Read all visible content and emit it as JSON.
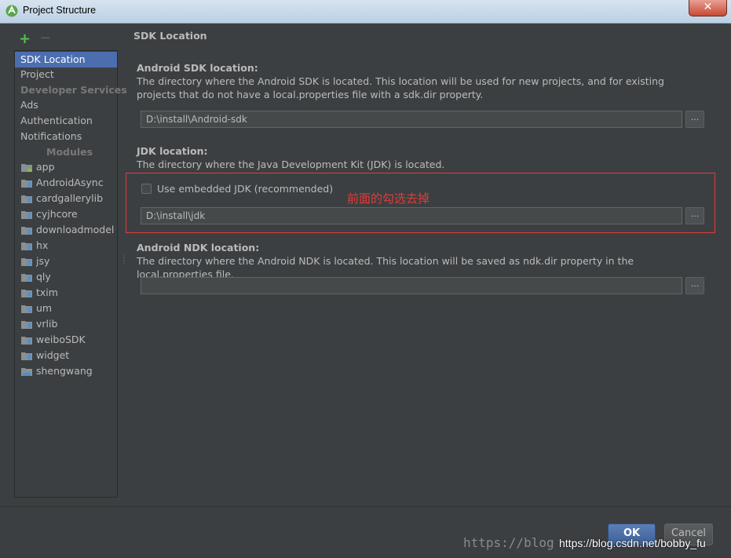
{
  "window": {
    "title": "Project Structure"
  },
  "toolbar": {
    "add_label": "+",
    "remove_label": "−"
  },
  "sidebar": {
    "items": [
      {
        "label": "SDK Location"
      },
      {
        "label": "Project"
      }
    ],
    "developer_services_header": "Developer Services",
    "developer_services": [
      {
        "label": "Ads"
      },
      {
        "label": "Authentication"
      },
      {
        "label": "Notifications"
      }
    ],
    "modules_header": "Modules",
    "modules": [
      {
        "label": "app"
      },
      {
        "label": "AndroidAsync"
      },
      {
        "label": "cardgallerylib"
      },
      {
        "label": "cyjhcore"
      },
      {
        "label": "downloadmodel"
      },
      {
        "label": "hx"
      },
      {
        "label": "jsy"
      },
      {
        "label": "qly"
      },
      {
        "label": "txim"
      },
      {
        "label": "um"
      },
      {
        "label": "vrlib"
      },
      {
        "label": "weiboSDK"
      },
      {
        "label": "widget"
      },
      {
        "label": "shengwang"
      }
    ]
  },
  "main": {
    "section_title": "SDK Location",
    "android_sdk": {
      "label": "Android SDK location:",
      "description": "The directory where the Android SDK is located. This location will be used for new projects, and for existing projects that do not have a local.properties file with a sdk.dir property.",
      "value": "D:\\install\\Android-sdk"
    },
    "jdk": {
      "label": "JDK location:",
      "description": "The directory where the Java Development Kit (JDK) is located.",
      "checkbox_label": "Use embedded JDK (recommended)",
      "checked": false,
      "value": "D:\\install\\jdk"
    },
    "ndk": {
      "label": "Android NDK location:",
      "description": "The directory where the Android NDK is located. This location will be saved as ndk.dir property in the local.properties file.",
      "value": ""
    },
    "browse_label": "...",
    "annotation": "前面的勾选去掉"
  },
  "footer": {
    "ok_label": "OK",
    "cancel_label": "Cancel",
    "watermark_url": "https://blog.csdn.net/bobby_fu",
    "watermark_faint": "https://blog"
  },
  "colors": {
    "background": "#3c3f41",
    "selection": "#4b6eaf",
    "annotation": "#e23b3b",
    "add": "#4fc44f"
  }
}
